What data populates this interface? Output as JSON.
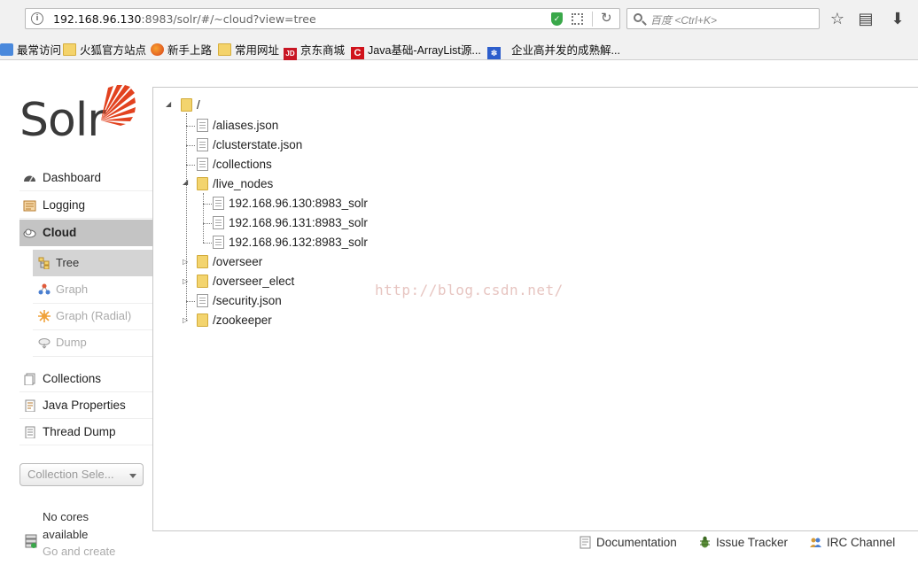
{
  "browser": {
    "url_host": "192.168.96.130",
    "url_rest": ":8983/solr/#/~cloud?view=tree",
    "search_placeholder": "百度 <Ctrl+K>",
    "bookmarks": [
      {
        "label": "最常访问",
        "icon": "star-icon"
      },
      {
        "label": "火狐官方站点",
        "icon": "folder-icon"
      },
      {
        "label": "新手上路",
        "icon": "firefox-icon"
      },
      {
        "label": "常用网址",
        "icon": "folder-icon"
      },
      {
        "label": "京东商城",
        "icon": "jd-icon"
      },
      {
        "label": "Java基础-ArrayList源...",
        "icon": "csdn-icon"
      },
      {
        "label": "企业高并发的成熟解...",
        "icon": "baidu-paw-icon"
      }
    ]
  },
  "logo": {
    "text": "Solr"
  },
  "menu": {
    "dashboard": "Dashboard",
    "logging": "Logging",
    "cloud": "Cloud",
    "cloud_sub": {
      "tree": "Tree",
      "graph": "Graph",
      "graph_radial": "Graph (Radial)",
      "dump": "Dump"
    },
    "collections": "Collections",
    "java_properties": "Java Properties",
    "thread_dump": "Thread Dump"
  },
  "collection_selector": {
    "placeholder": "Collection Sele..."
  },
  "no_cores": {
    "line1": "No cores",
    "line2": "available",
    "line3": "Go and create"
  },
  "tree": {
    "root": "/",
    "nodes": [
      "/aliases.json",
      "/clusterstate.json",
      "/collections",
      "/live_nodes",
      "192.168.96.130:8983_solr",
      "192.168.96.131:8983_solr",
      "192.168.96.132:8983_solr",
      "/overseer",
      "/overseer_elect",
      "/security.json",
      "/zookeeper"
    ]
  },
  "watermark": "http://blog.csdn.net/",
  "footer": {
    "documentation": "Documentation",
    "issue_tracker": "Issue Tracker",
    "irc_channel": "IRC Channel"
  }
}
